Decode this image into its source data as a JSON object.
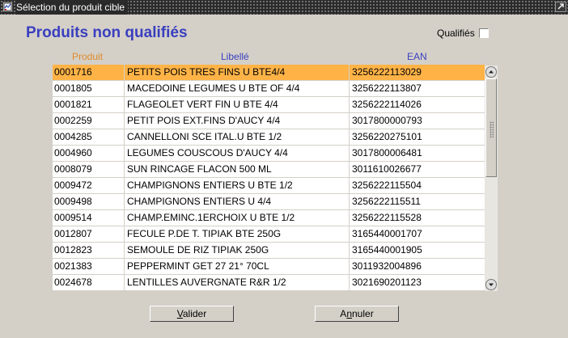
{
  "window": {
    "title": "Sélection du produit cible",
    "app_icon": "app-icon",
    "restore_icon": "restore-icon"
  },
  "heading": "Produits non qualifiés",
  "qualifies": {
    "label": "Qualifiés",
    "checked": false
  },
  "table": {
    "columns": [
      "Produit",
      "Libellé",
      "EAN"
    ],
    "selected_index": 0,
    "rows": [
      [
        "0001716",
        "PETITS POIS TRES FINS U BTE4/4",
        "3256222113029"
      ],
      [
        "0001805",
        "MACEDOINE LEGUMES U BTE OF 4/4",
        "3256222113807"
      ],
      [
        "0001821",
        "FLAGEOLET VERT FIN U BTE 4/4",
        "3256222114026"
      ],
      [
        "0002259",
        "PETIT POIS EXT.FINS D'AUCY 4/4",
        "3017800000793"
      ],
      [
        "0004285",
        "CANNELLONI SCE ITAL.U BTE 1/2",
        "3256220275101"
      ],
      [
        "0004960",
        "LEGUMES COUSCOUS D'AUCY 4/4",
        "3017800006481"
      ],
      [
        "0008079",
        "SUN RINCAGE FLACON 500 ML",
        "3011610026677"
      ],
      [
        "0009472",
        "CHAMPIGNONS ENTIERS U BTE 1/2",
        "3256222115504"
      ],
      [
        "0009498",
        "CHAMPIGNONS ENTIERS U 4/4",
        "3256222115511"
      ],
      [
        "0009514",
        "CHAMP.EMINC.1ERCHOIX U BTE 1/2",
        "3256222115528"
      ],
      [
        "0012807",
        "FECULE P.DE T. TIPIAK BTE 250G",
        "3165440001707"
      ],
      [
        "0012823",
        "SEMOULE DE RIZ TIPIAK 250G",
        "3165440001905"
      ],
      [
        "0021383",
        "PEPPERMINT GET 27 21° 70CL",
        "3011932004896"
      ],
      [
        "0024678",
        "LENTILLES AUVERGNATE R&R 1/2",
        "3021690201123"
      ]
    ]
  },
  "scrollbar": {
    "up_icon": "scroll-up-arrow-icon",
    "down_icon": "scroll-down-arrow-icon"
  },
  "buttons": {
    "valider": {
      "label": "Valider",
      "mnemonic_index": 0
    },
    "annuler": {
      "label": "Annuler",
      "mnemonic_index": 1
    }
  },
  "colors": {
    "heading": "#3a3fbf",
    "selected_row": "#ffb347",
    "produit_header": "#e08a2a",
    "window_bg": "#d4d0c8"
  }
}
